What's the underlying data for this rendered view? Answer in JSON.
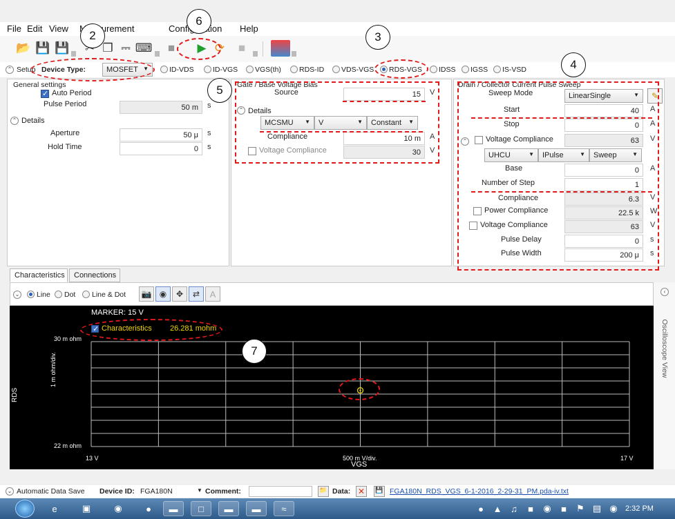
{
  "menu": [
    "File",
    "Edit",
    "View",
    "Measurement",
    "Configuration",
    "Help"
  ],
  "modebar": {
    "setup_label": "Setup",
    "device_type_label": "Device Type:",
    "device_type_value": "MOSFET",
    "modes": [
      {
        "label": "ID-VDS",
        "selected": false
      },
      {
        "label": "ID-VGS",
        "selected": false
      },
      {
        "label": "VGS(th)",
        "selected": false
      },
      {
        "label": "RDS-ID",
        "selected": false
      },
      {
        "label": "VDS-VGS",
        "selected": false
      },
      {
        "label": "RDS-VGS",
        "selected": true
      },
      {
        "label": "IDSS",
        "selected": false
      },
      {
        "label": "IGSS",
        "selected": false
      },
      {
        "label": "IS-VSD",
        "selected": false
      }
    ]
  },
  "general": {
    "title": "General settings",
    "auto_period_label": "Auto Period",
    "pulse_period_label": "Pulse Period",
    "pulse_period_value": "50 m",
    "pulse_period_unit": "s",
    "details_label": "Details",
    "aperture_label": "Aperture",
    "aperture_value": "50 μ",
    "aperture_unit": "s",
    "hold_time_label": "Hold Time",
    "hold_time_value": "0",
    "hold_time_unit": "s"
  },
  "gate": {
    "title": "Gate / Base Voltage Bias",
    "source_label": "Source",
    "source_value": "15",
    "source_unit": "V",
    "details_label": "Details",
    "smu_value": "MCSMU",
    "mode_value": "V",
    "shape_value": "Constant",
    "compliance_label": "Compliance",
    "compliance_value": "10 m",
    "compliance_unit": "A",
    "vcomp_label": "Voltage Compliance",
    "vcomp_value": "30",
    "vcomp_unit": "V"
  },
  "drain": {
    "title": "Drain / Collector Current Pulse Sweep",
    "sweep_mode_label": "Sweep Mode",
    "sweep_mode_value": "LinearSingle",
    "start_label": "Start",
    "start_value": "40",
    "start_unit": "A",
    "stop_label": "Stop",
    "stop_value": "0",
    "stop_unit": "A",
    "vcomp_label": "Voltage Compliance",
    "vcomp_value": "63",
    "vcomp_unit": "V",
    "unit_value": "UHCU",
    "pulse_value": "IPulse",
    "sweep_value": "Sweep",
    "base_label": "Base",
    "base_value": "0",
    "base_unit": "A",
    "nsteps_label": "Number of Step",
    "nsteps_value": "1",
    "compliance_label": "Compliance",
    "compliance_value": "6.3",
    "compliance_unit": "V",
    "pcomp_label": "Power Compliance",
    "pcomp_value": "22.5 k",
    "pcomp_unit": "W",
    "vcomp2_label": "Voltage Compliance",
    "vcomp2_value": "63",
    "vcomp2_unit": "V",
    "pulse_delay_label": "Pulse Delay",
    "pulse_delay_value": "0",
    "pulse_delay_unit": "s",
    "pulse_width_label": "Pulse Width",
    "pulse_width_value": "200 μ",
    "pulse_width_unit": "s"
  },
  "tabs": [
    "Characteristics",
    "Connections"
  ],
  "plotbar": {
    "line": "Line",
    "dot": "Dot",
    "linedot": "Line & Dot"
  },
  "side_label": "Oscilloscope View",
  "plot": {
    "marker_text": "MARKER: 15 V",
    "legend_name": "Characteristics",
    "legend_value": "26.281 mohm",
    "ytop": "30 m ohm",
    "ybottom": "22 m ohm",
    "ydiv": "1 m ohm/div.",
    "yaxis": "RDS",
    "xleft": "13 V",
    "xright": "17 V",
    "xdiv": "500 m V/div.",
    "xaxis": "VGS"
  },
  "chart_data": {
    "type": "scatter",
    "x": [
      15
    ],
    "y": [
      26.281
    ],
    "xlabel": "VGS",
    "ylabel": "RDS",
    "xlim": [
      13,
      17
    ],
    "ylim": [
      22,
      30
    ],
    "grid": true
  },
  "status": {
    "auto_save_label": "Automatic Data Save",
    "device_id_label": "Device ID:",
    "device_id_value": "FGA180N",
    "comment_label": "Comment:",
    "data_label": "Data:",
    "file_name": "FGA180N_RDS_VGS_6-1-2016_2-29-31_PM.pda-iv.txt"
  },
  "taskbar": {
    "clock": "2:32 PM"
  },
  "annotations": [
    "2",
    "3",
    "4",
    "5",
    "6",
    "7"
  ],
  "colors": {
    "accent": "#e0191b",
    "trace": "#f2d600",
    "link": "#1a4fb0"
  }
}
